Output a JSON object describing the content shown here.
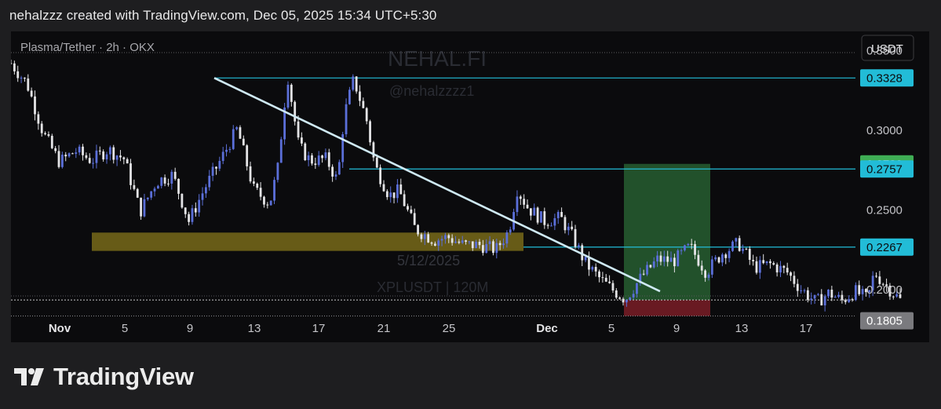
{
  "header": {
    "attribution": "nehalzzz created with TradingView.com, Dec 05, 2025 15:34 UTC+5:30"
  },
  "footer": {
    "brand": "TradingView"
  },
  "chart_data": {
    "type": "candlestick",
    "symbol_info": "Plasma/Tether · 2h · OKX",
    "watermark_title": "NEHAL.FI",
    "watermark_handle": "@nehalzzzz1",
    "watermark_symbol": "XPLUSDT | 120M",
    "watermark_date": "5/12/2025",
    "currency_button": "USDT",
    "ylim": [
      0.167,
      0.362
    ],
    "y_ticks": [
      "0.3500",
      "0.2000"
    ],
    "y_ticks_partially_hidden": [
      "0.3000",
      "0.2500"
    ],
    "x_ticks": [
      "Nov",
      "5",
      "9",
      "13",
      "17",
      "21",
      "25",
      "Dec",
      "5",
      "9",
      "13",
      "17"
    ],
    "price_levels": [
      {
        "label": "0.3328",
        "value": 0.3328,
        "color": "#22bcd7",
        "text_color": "#0b0b0d"
      },
      {
        "label": "0.2789",
        "value": 0.2789,
        "color": "#3fae55",
        "text_color": "#ffffff"
      },
      {
        "label": "0.2757",
        "value": 0.2757,
        "color": "#22bcd7",
        "text_color": "#0b0b0d"
      },
      {
        "label": "0.2267",
        "value": 0.2267,
        "color": "#22bcd7",
        "text_color": "#0b0b0d"
      },
      {
        "label": "0.1805",
        "value": 0.1805,
        "color": "#7a7a7e",
        "text_color": "#ffffff"
      }
    ],
    "last_price": 0.1935,
    "trendline": {
      "from": {
        "date": "Nov 11",
        "price": 0.3328
      },
      "to": {
        "date": "Dec 8",
        "price": 0.199
      }
    },
    "support_zone": {
      "from": "Oct 27",
      "to": "Dec 1",
      "price_low": 0.2243,
      "price_high": 0.2358
    },
    "long_position": {
      "entry": 0.1935,
      "take_profit": 0.2789,
      "stop_loss": 0.1835
    },
    "series": [
      {
        "name": "XPLUSDT",
        "anchors": [
          [
            0,
            0.342
          ],
          [
            1,
            0.329
          ],
          [
            2,
            0.298
          ],
          [
            3,
            0.28
          ],
          [
            4,
            0.287
          ],
          [
            5,
            0.281
          ],
          [
            6,
            0.288
          ],
          [
            7,
            0.282
          ],
          [
            8,
            0.249
          ],
          [
            9,
            0.268
          ],
          [
            10,
            0.272
          ],
          [
            11,
            0.243
          ],
          [
            12,
            0.264
          ],
          [
            13,
            0.282
          ],
          [
            14,
            0.301
          ],
          [
            15,
            0.263
          ],
          [
            16,
            0.254
          ],
          [
            16.5,
            0.276
          ],
          [
            17.1,
            0.335
          ],
          [
            17.8,
            0.29
          ],
          [
            18.5,
            0.281
          ],
          [
            19.5,
            0.282
          ],
          [
            20.2,
            0.268
          ],
          [
            20.6,
            0.309
          ],
          [
            21.2,
            0.332
          ],
          [
            22.0,
            0.306
          ],
          [
            22.5,
            0.278
          ],
          [
            23.4,
            0.259
          ],
          [
            24,
            0.262
          ],
          [
            25,
            0.238
          ],
          [
            26.2,
            0.231
          ],
          [
            27.0,
            0.233
          ],
          [
            28.0,
            0.228
          ],
          [
            29,
            0.228
          ],
          [
            30,
            0.225
          ],
          [
            30.8,
            0.237
          ],
          [
            31.3,
            0.263
          ],
          [
            32,
            0.251
          ],
          [
            33,
            0.243
          ],
          [
            34,
            0.245
          ],
          [
            34.8,
            0.232
          ],
          [
            35.5,
            0.217
          ],
          [
            36.5,
            0.206
          ],
          [
            37.2,
            0.2
          ],
          [
            38.0,
            0.194
          ],
          [
            39.0,
            0.208
          ],
          [
            40,
            0.219
          ],
          [
            41,
            0.218
          ],
          [
            42,
            0.227
          ],
          [
            43,
            0.211
          ],
          [
            44,
            0.223
          ],
          [
            45,
            0.229
          ],
          [
            46,
            0.214
          ],
          [
            47,
            0.216
          ],
          [
            48,
            0.211
          ],
          [
            48.8,
            0.201
          ],
          [
            49.8,
            0.192
          ],
          [
            50.6,
            0.198
          ],
          [
            51.4,
            0.193
          ],
          [
            52.2,
            0.199
          ],
          [
            53,
            0.194
          ],
          [
            53.4,
            0.211
          ],
          [
            54,
            0.204
          ],
          [
            55,
            0.1935
          ]
        ]
      }
    ]
  }
}
